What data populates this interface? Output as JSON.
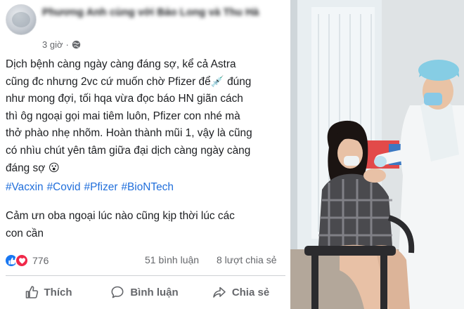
{
  "post": {
    "author": "Phương Anh cùng với Bảo Long và Thu Hà",
    "time": "3 giờ",
    "body": "Dịch bệnh càng ngày càng đáng sợ, kể cả Astra\ncũng đc nhưng 2vc cứ muốn chờ Pfizer để💉 đúng\nnhư mong đợi, tối hqa vừa đọc báo HN giãn cách\nthì ôg ngoại gọi mai tiêm luôn, Pfizer con nhé mà\nthở phào nhẹ nhõm. Hoàn thành mũi 1, vậy là cũng\ncó nhìu chút yên tâm giữa đại dịch càng ngày càng\nđáng sợ 😮",
    "hashtags": [
      "#Vacxin",
      "#Covid",
      "#Pfizer",
      "#BioNTech"
    ],
    "footer_text": "Cảm ưn oba ngoại lúc nào cũng kịp thời lúc các\ncon cần",
    "reaction_count": "776",
    "comments": "51 bình luận",
    "shares": "8 lượt chia sẻ"
  },
  "actions": {
    "like": "Thích",
    "comment": "Bình luận",
    "share": "Chia sẻ"
  },
  "icons": {
    "privacy": "globe-icon",
    "more": "more-icon",
    "like_reaction": "like-reaction-icon",
    "love_reaction": "love-reaction-icon",
    "like_action": "thumbs-up-icon",
    "comment_action": "speech-bubble-icon",
    "share_action": "share-arrow-icon"
  },
  "colors": {
    "hashtag": "#216fdb",
    "like_blue": "#1877f2",
    "love_red": "#f02849",
    "muted_text": "#65676b"
  }
}
